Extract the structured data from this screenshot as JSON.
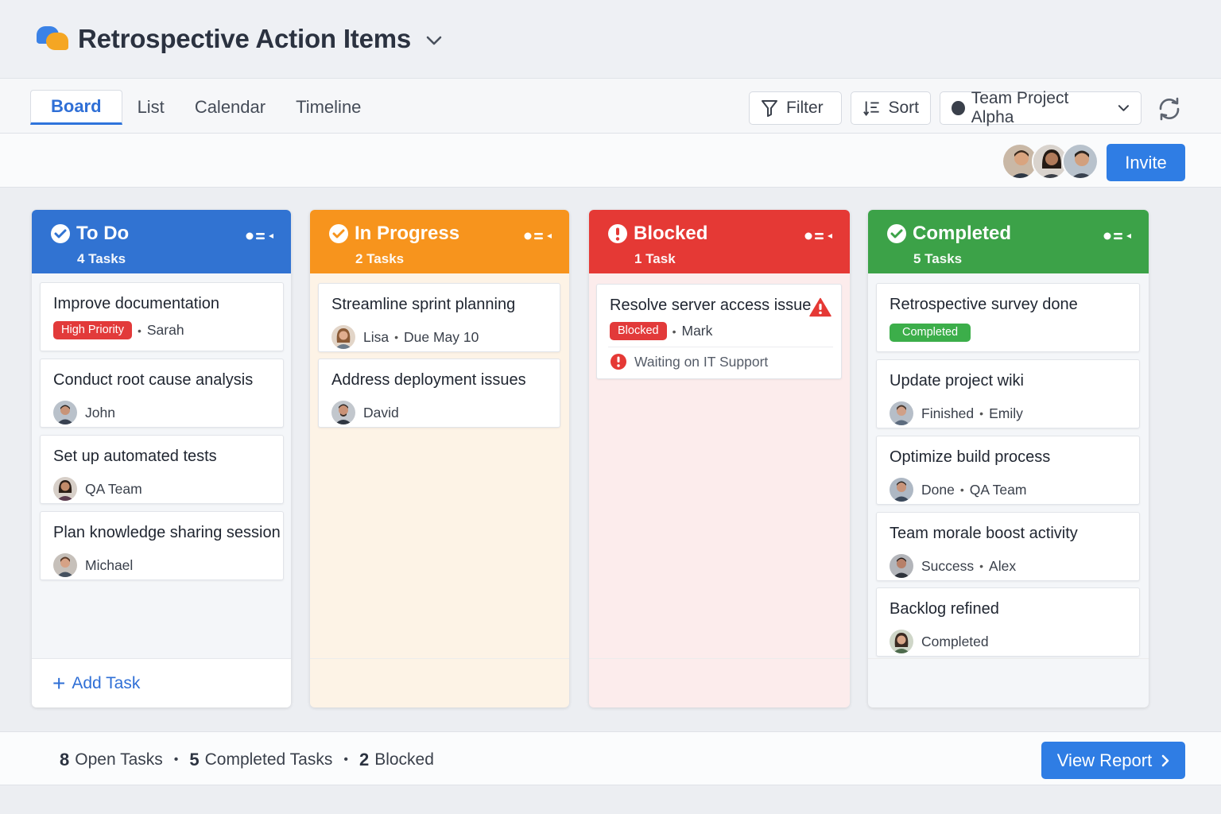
{
  "app": {
    "title": "Retrospective Action Items",
    "icon": "chat-bubbles-icon"
  },
  "tabs": [
    {
      "label": "Board",
      "active": true
    },
    {
      "label": "List",
      "active": false
    },
    {
      "label": "Calendar",
      "active": false
    },
    {
      "label": "Timeline",
      "active": false
    }
  ],
  "toolbar": {
    "filter_label": "Filter",
    "sort_label": "Sort",
    "project_label": "Team Project Alpha"
  },
  "people": {
    "invite_label": "Invite",
    "avatars": [
      "avatar-1",
      "avatar-2",
      "avatar-3"
    ]
  },
  "columns": [
    {
      "title": "To Do",
      "count": "4 Tasks",
      "color": "#3173d2",
      "cards": [
        {
          "title": "Improve documentation",
          "badge": "High Priority",
          "person": "Sarah"
        },
        {
          "title": "Conduct root cause analysis",
          "person": "John"
        },
        {
          "title": "Set up automated tests",
          "person": "QA Team"
        },
        {
          "title": "Plan knowledge sharing session",
          "person": "Michael"
        }
      ],
      "add_label": "Add Task"
    },
    {
      "title": "In Progress",
      "count": "2 Tasks",
      "color": "#f7941d",
      "cards": [
        {
          "title": "Streamline sprint planning",
          "person": "Lisa",
          "due": "Due May 10"
        },
        {
          "title": "Address deployment issues",
          "person": "David"
        }
      ]
    },
    {
      "title": "Blocked",
      "count": "1 Task",
      "color": "#e53935",
      "cards": [
        {
          "title": "Resolve server access issue",
          "badge": "Blocked",
          "person": "Mark",
          "note": "Waiting on IT Support"
        }
      ]
    },
    {
      "title": "Completed",
      "count": "5 Tasks",
      "color": "#3ca248",
      "cards": [
        {
          "title": "Retrospective survey done",
          "badge": "Completed"
        },
        {
          "title": "Update project wiki",
          "status": "Finished",
          "person": "Emily"
        },
        {
          "title": "Optimize build process",
          "status": "Done",
          "person": "QA Team"
        },
        {
          "title": "Team morale boost activity",
          "status": "Success",
          "person": "Alex"
        },
        {
          "title": "Backlog refined",
          "status": "Completed"
        }
      ]
    }
  ],
  "footer": {
    "open_count": "8",
    "open_label": "Open Tasks",
    "completed_count": "5",
    "completed_label": "Completed Tasks",
    "blocked_count": "2",
    "blocked_label": "Blocked",
    "report_label": "View Report"
  }
}
